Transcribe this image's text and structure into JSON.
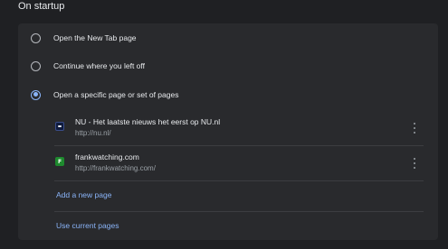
{
  "section_title": "On startup",
  "accent_color": "#8ab4f8",
  "options": [
    {
      "label": "Open the New Tab page",
      "checked": false
    },
    {
      "label": "Continue where you left off",
      "checked": false
    },
    {
      "label": "Open a specific page or set of pages",
      "checked": true
    }
  ],
  "pages": [
    {
      "title": "NU - Het laatste nieuws het eerst op NU.nl",
      "url": "http://nu.nl/",
      "icon": "nu-favicon-icon"
    },
    {
      "title": "frankwatching.com",
      "url": "http://frankwatching.com/",
      "icon": "frankwatching-favicon-icon",
      "icon_letter": "F"
    }
  ],
  "add_page_label": "Add a new page",
  "use_current_label": "Use current pages"
}
